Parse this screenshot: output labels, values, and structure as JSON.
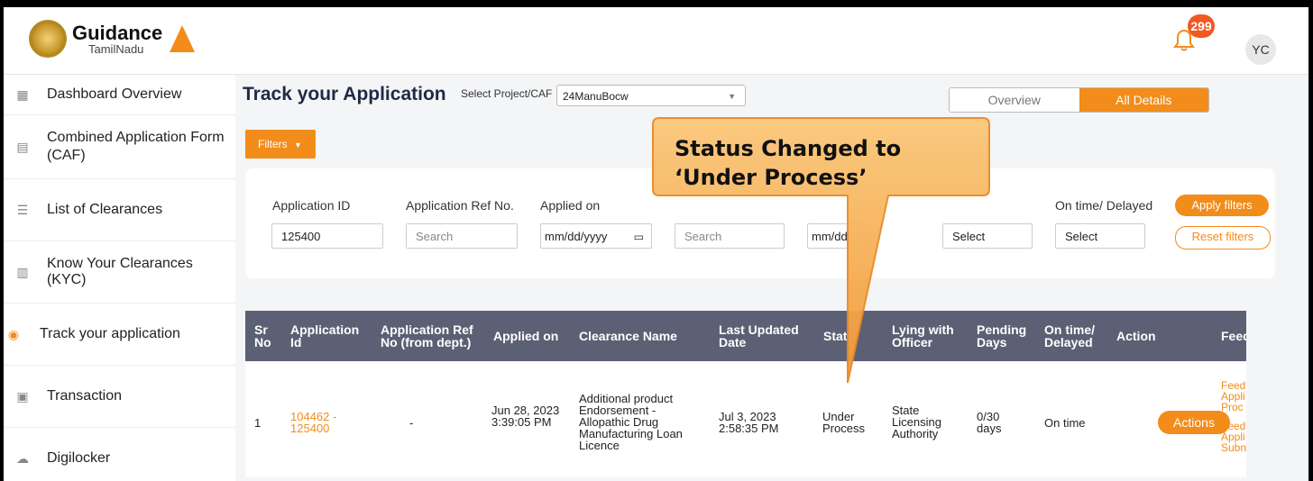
{
  "brand": {
    "name": "Guidance",
    "sub": "TamilNadu"
  },
  "header": {
    "notifications_count": "299",
    "avatar_initials": "YC"
  },
  "sidebar": {
    "items": [
      {
        "label": "Dashboard Overview",
        "icon": "dashboard-icon"
      },
      {
        "label": "Combined Application Form (CAF)",
        "icon": "document-icon"
      },
      {
        "label": "List of Clearances",
        "icon": "list-icon"
      },
      {
        "label": "Know Your Clearances (KYC)",
        "icon": "book-icon"
      },
      {
        "label": "Track your application",
        "icon": "location-pin-icon",
        "active": true
      },
      {
        "label": "Transaction",
        "icon": "transaction-icon"
      },
      {
        "label": "Digilocker",
        "icon": "cloud-icon"
      }
    ]
  },
  "main": {
    "title": "Track your Application",
    "select_label": "Select Project/CAF",
    "select_value": "24ManuBocw",
    "tabs": {
      "overview": "Overview",
      "all_details": "All Details"
    },
    "filters_label": "Filters"
  },
  "filters": {
    "application_id_label": "Application ID",
    "application_id_value": "125400",
    "app_ref_label": "Application Ref No.",
    "app_ref_placeholder": "Search",
    "applied_on_label": "Applied on",
    "applied_on_placeholder": "mm/dd/yyyy",
    "search_placeholder": "Search",
    "date2_placeholder": "mm/dd",
    "select1": "Select",
    "ontime_label": "On time/ Delayed",
    "select2": "Select",
    "apply_label": "Apply filters",
    "reset_label": "Reset filters"
  },
  "table": {
    "headers": {
      "sr": "Sr No",
      "app_id": "Application Id",
      "app_ref": "Application Ref No (from dept.)",
      "applied_on": "Applied on",
      "clearance": "Clearance Name",
      "last_updated": "Last Updated Date",
      "status": "Stat",
      "lying": "Lying with Officer",
      "pending": "Pending Days",
      "ontime": "On time/ Delayed",
      "action": "Action",
      "feedback": "Feed"
    },
    "row": {
      "sr": "1",
      "app_id": "104462 - 125400",
      "app_ref": "-",
      "applied_on": "Jun 28, 2023 3:39:05 PM",
      "clearance": "Additional product Endorsement - Allopathic Drug Manufacturing Loan Licence",
      "last_updated": "Jul 3, 2023 2:58:35 PM",
      "status": "Under Process",
      "lying": "State Licensing Authority",
      "pending": "0/30 days",
      "ontime": "On time",
      "action": "Actions",
      "feedback1": "Feed Appli Proc",
      "feedback2": "Feed Appli Subn"
    }
  },
  "callout": {
    "line1": "Status Changed to",
    "line2": "‘Under Process’"
  },
  "colors": {
    "accent": "#f28c1b",
    "table_header": "#5c6074",
    "badge": "#f05a22"
  }
}
